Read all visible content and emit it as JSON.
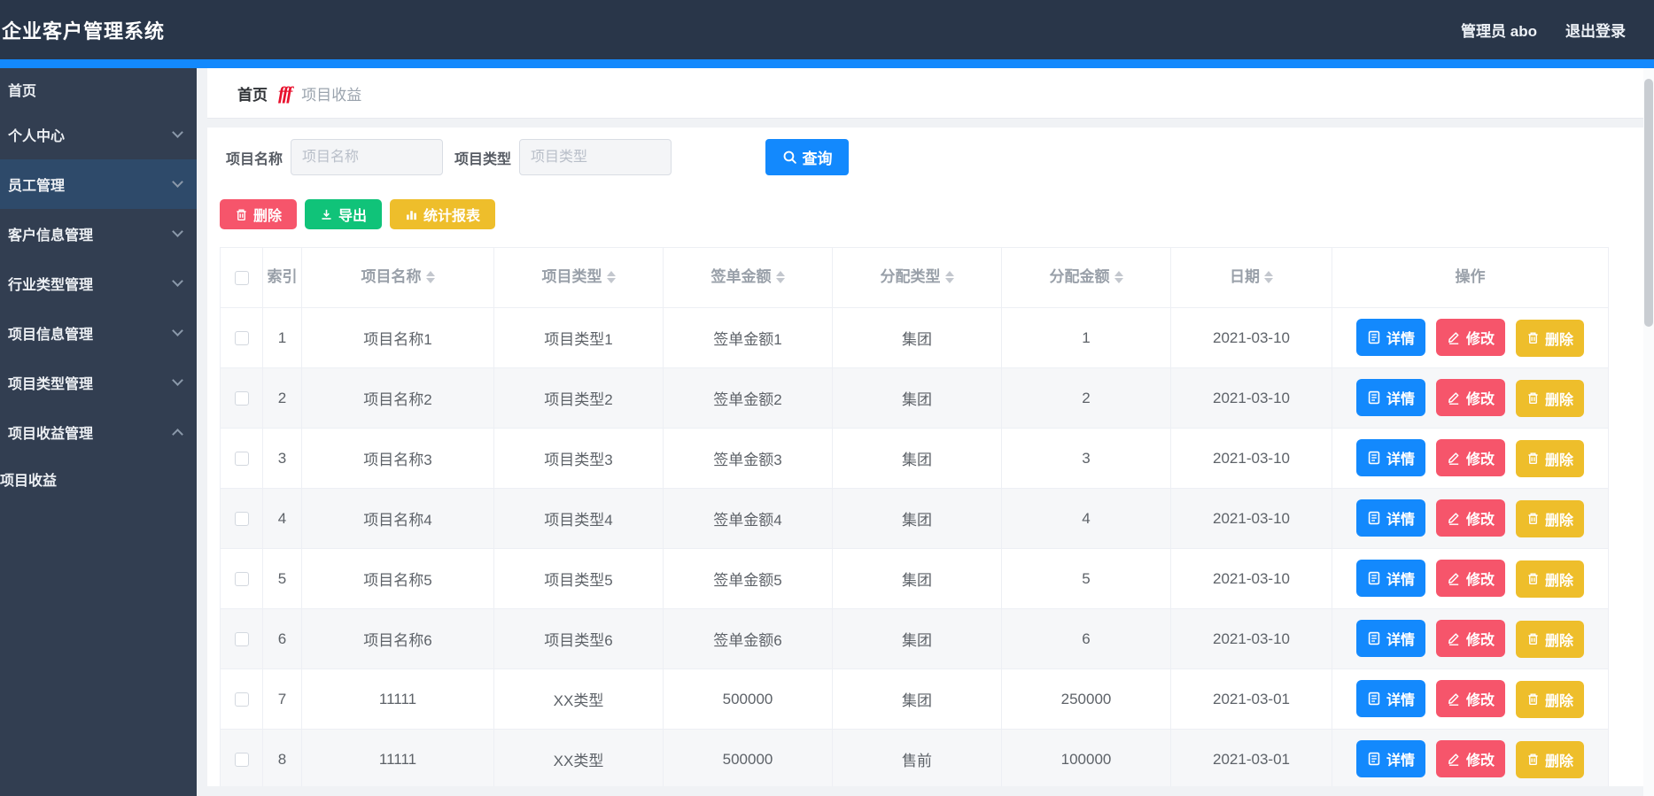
{
  "app": {
    "title": "企业客户管理系统",
    "user": "管理员 abo",
    "logout": "退出登录"
  },
  "colors": {
    "accent": "#1389fd",
    "navbar": "#293649",
    "sidebar": "#323e51",
    "sidebar_active": "#2e4a6a",
    "red": "#f6556b",
    "green": "#10c379",
    "yellow": "#eebe2b"
  },
  "sidebar": {
    "items": [
      {
        "label": "首页",
        "arrow": "none",
        "active": false,
        "sub": false
      },
      {
        "label": "个人中心",
        "arrow": "down",
        "active": false,
        "sub": false
      },
      {
        "label": "员工管理",
        "arrow": "down",
        "active": true,
        "sub": false
      },
      {
        "label": "客户信息管理",
        "arrow": "down",
        "active": false,
        "sub": false
      },
      {
        "label": "行业类型管理",
        "arrow": "down",
        "active": false,
        "sub": false
      },
      {
        "label": "项目信息管理",
        "arrow": "down",
        "active": false,
        "sub": false
      },
      {
        "label": "项目类型管理",
        "arrow": "down",
        "active": false,
        "sub": false
      },
      {
        "label": "项目收益管理",
        "arrow": "up",
        "active": false,
        "sub": false
      },
      {
        "label": "项目收益",
        "arrow": "none",
        "active": false,
        "sub": true
      }
    ]
  },
  "breadcrumb": {
    "home": "首页",
    "separator_glyph": "fff",
    "current": "项目收益"
  },
  "filters": {
    "name_label": "项目名称",
    "name_placeholder": "项目名称",
    "name_value": "",
    "type_label": "项目类型",
    "type_placeholder": "项目类型",
    "type_value": "",
    "search_label": "查询"
  },
  "toolbar": {
    "delete_label": "删除",
    "export_label": "导出",
    "report_label": "统计报表"
  },
  "table": {
    "headers": [
      {
        "label": "索引",
        "sortable": false
      },
      {
        "label": "项目名称",
        "sortable": true
      },
      {
        "label": "项目类型",
        "sortable": true
      },
      {
        "label": "签单金额",
        "sortable": true
      },
      {
        "label": "分配类型",
        "sortable": true
      },
      {
        "label": "分配金额",
        "sortable": true
      },
      {
        "label": "日期",
        "sortable": true
      },
      {
        "label": "操作",
        "sortable": false
      }
    ],
    "rows": [
      [
        "1",
        "项目名称1",
        "项目类型1",
        "签单金额1",
        "集团",
        "1",
        "2021-03-10"
      ],
      [
        "2",
        "项目名称2",
        "项目类型2",
        "签单金额2",
        "集团",
        "2",
        "2021-03-10"
      ],
      [
        "3",
        "项目名称3",
        "项目类型3",
        "签单金额3",
        "集团",
        "3",
        "2021-03-10"
      ],
      [
        "4",
        "项目名称4",
        "项目类型4",
        "签单金额4",
        "集团",
        "4",
        "2021-03-10"
      ],
      [
        "5",
        "项目名称5",
        "项目类型5",
        "签单金额5",
        "集团",
        "5",
        "2021-03-10"
      ],
      [
        "6",
        "项目名称6",
        "项目类型6",
        "签单金额6",
        "集团",
        "6",
        "2021-03-10"
      ],
      [
        "7",
        "11111",
        "XX类型",
        "500000",
        "集团",
        "250000",
        "2021-03-01"
      ],
      [
        "8",
        "11111",
        "XX类型",
        "500000",
        "售前",
        "100000",
        "2021-03-01"
      ]
    ],
    "row_actions": {
      "detail": "详情",
      "edit": "修改",
      "delete": "删除"
    }
  }
}
